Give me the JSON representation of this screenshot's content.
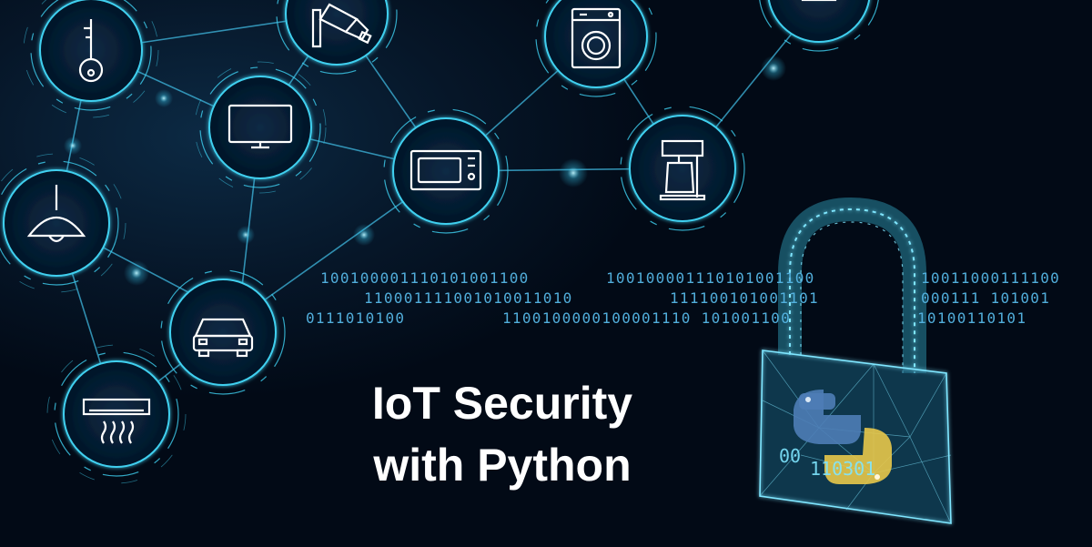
{
  "title": {
    "line1": "IoT Security",
    "line2": "with Python"
  },
  "binary_rows": [
    "100100001110101001100",
    "100100001110101001100",
    "10011000111100",
    "110001111001010011010",
    "111100101001101",
    "000111 101001",
    "0111010100",
    "1100100000100001110 101001100",
    "10100110101"
  ],
  "icons": [
    "key-icon",
    "security-camera-icon",
    "washing-machine-icon",
    "tv-icon",
    "microwave-icon",
    "coffee-maker-icon",
    "ceiling-lamp-icon",
    "car-icon",
    "air-conditioner-icon",
    "padlock-icon",
    "python-logo-icon"
  ],
  "colors": {
    "background": "#020a16",
    "glow": "#3fd0f0",
    "node_fill": "#041628",
    "lock_fill": "#1a5d7a",
    "binary": "#56b7e6",
    "title": "#ffffff",
    "python_blue": "#4e7db6",
    "python_yellow": "#e8c84a"
  }
}
